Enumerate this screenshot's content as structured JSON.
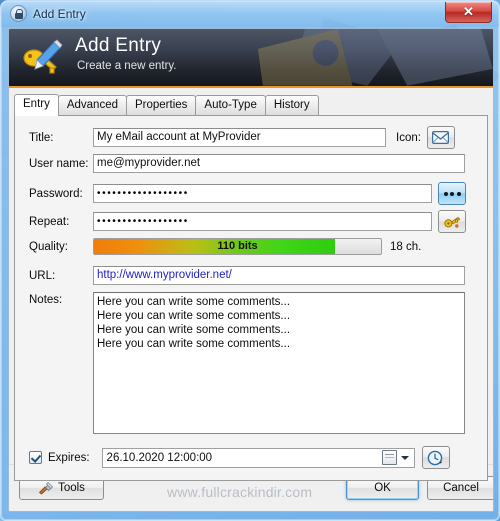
{
  "window": {
    "title": "Add Entry",
    "title_icon": "lock-icon",
    "close_label": "✕"
  },
  "banner": {
    "title": "Add Entry",
    "subtitle": "Create a new entry.",
    "icon": "key-pencil-icon"
  },
  "tabs": [
    {
      "label": "Entry",
      "active": true
    },
    {
      "label": "Advanced",
      "active": false
    },
    {
      "label": "Properties",
      "active": false
    },
    {
      "label": "Auto-Type",
      "active": false
    },
    {
      "label": "History",
      "active": false
    }
  ],
  "fields": {
    "title_label": "Title:",
    "title_value": "My eMail account at MyProvider",
    "icon_label": "Icon:",
    "icon_button": "envelope-icon",
    "username_label": "User name:",
    "username_value": "me@myprovider.net",
    "password_label": "Password:",
    "password_value": "••••••••••••••••••",
    "password_toggle_icon": "three-dots-icon",
    "repeat_label": "Repeat:",
    "repeat_value": "••••••••••••••••••",
    "generate_icon": "key-generator-icon",
    "quality_label": "Quality:",
    "quality_bits": "110 bits",
    "quality_percent": 84,
    "quality_chars": "18 ch.",
    "url_label": "URL:",
    "url_value": "http://www.myprovider.net/",
    "notes_label": "Notes:",
    "notes_lines": [
      "Here you can write some comments...",
      "Here you can write some comments...",
      "Here you can write some comments...",
      "Here you can write some comments..."
    ],
    "expires_label": "Expires:",
    "expires_checked": true,
    "expires_value": "26.10.2020 12:00:00",
    "expires_calendar_icon": "calendar-icon",
    "expires_preset_icon": "clock-icon"
  },
  "buttons": {
    "tools": "Tools",
    "tools_icon": "tools-icon",
    "ok": "OK",
    "cancel": "Cancel"
  },
  "watermark": "www.fullcrackindir.com",
  "colors": {
    "accent_orange": "#e8972a",
    "quality_start": "#ef7d0a",
    "quality_end": "#2ecc0f",
    "link": "#2323c8",
    "close_red": "#d64a43",
    "hex_teal": "#6fc6cf"
  }
}
